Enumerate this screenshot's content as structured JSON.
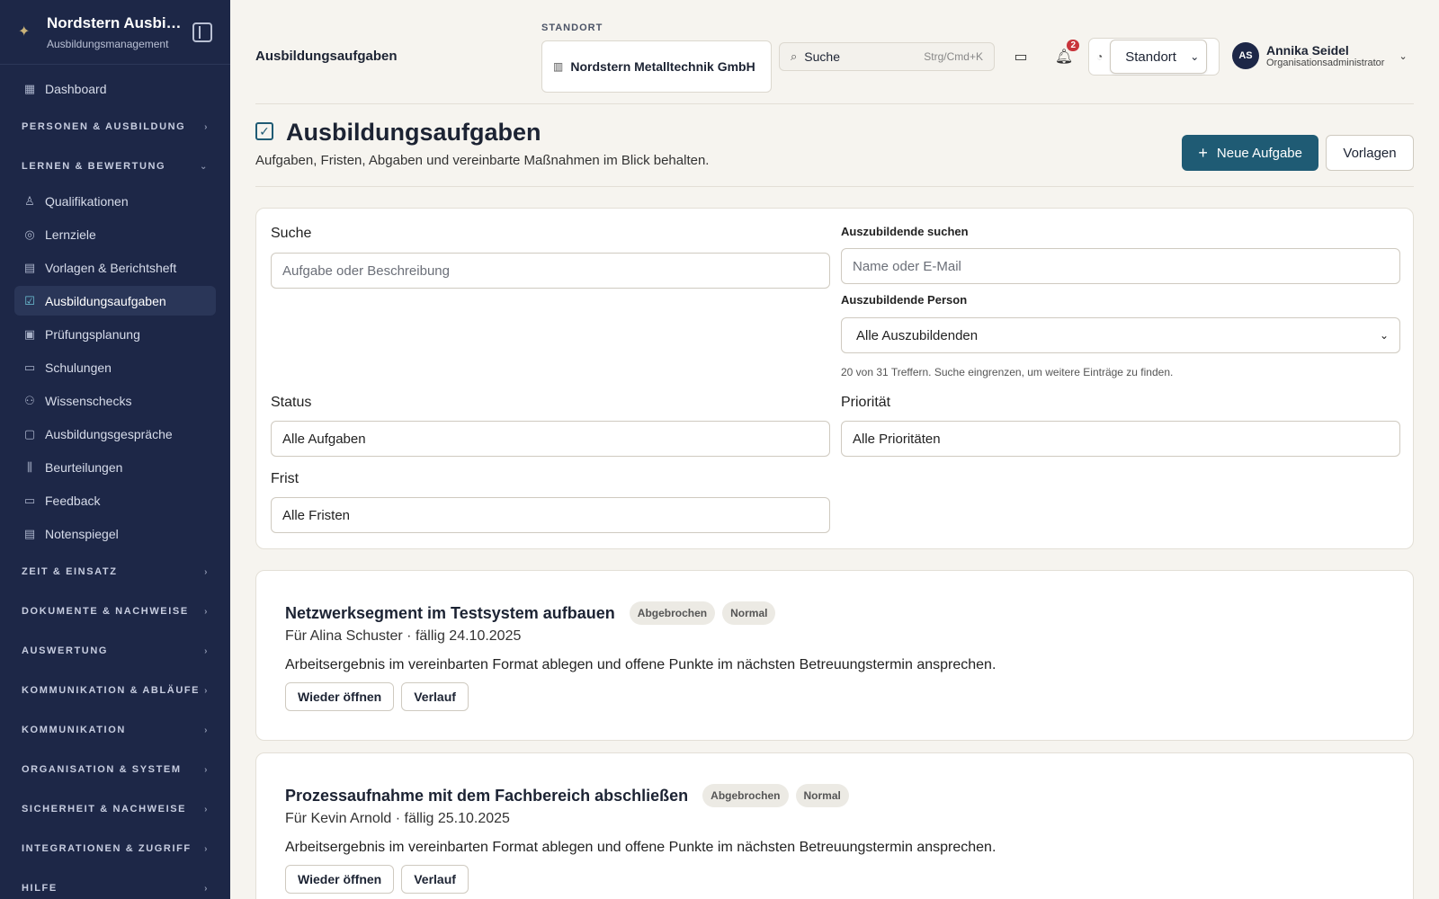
{
  "app": {
    "title": "Nordstern Ausbildungsportal",
    "subtitle": "Ausbildungsmanagement"
  },
  "sidebar": {
    "dashboard": "Dashboard",
    "sections": {
      "personen": "PERSONEN & AUSBILDUNG",
      "lernen": "LERNEN & BEWERTUNG",
      "zeit": "ZEIT & EINSATZ",
      "dokumente": "DOKUMENTE & NACHWEISE",
      "auswertung": "AUSWERTUNG",
      "kommAblaeufe": "KOMMUNIKATION & ABLÄUFE",
      "kommunikation": "KOMMUNIKATION",
      "organisation": "ORGANISATION & SYSTEM",
      "sicherheit": "SICHERHEIT & NACHWEISE",
      "integrationen": "INTEGRATIONEN & ZUGRIFF",
      "hilfe": "HILFE"
    },
    "items": [
      {
        "label": "Qualifikationen",
        "icon": "award-icon"
      },
      {
        "label": "Lernziele",
        "icon": "target-icon"
      },
      {
        "label": "Vorlagen & Berichtsheft",
        "icon": "document-icon"
      },
      {
        "label": "Ausbildungsaufgaben",
        "icon": "checkbox-icon"
      },
      {
        "label": "Prüfungsplanung",
        "icon": "calendar-icon"
      },
      {
        "label": "Schulungen",
        "icon": "book-icon"
      },
      {
        "label": "Wissenschecks",
        "icon": "brain-icon"
      },
      {
        "label": "Ausbildungsgespräche",
        "icon": "chat-icon"
      },
      {
        "label": "Beurteilungen",
        "icon": "bar-chart-icon"
      },
      {
        "label": "Feedback",
        "icon": "message-icon"
      },
      {
        "label": "Notenspiegel",
        "icon": "file-icon"
      }
    ]
  },
  "topbar": {
    "page_title": "Ausbildungsaufgaben",
    "location_label": "STANDORT",
    "location_value": "Nordstern Metalltechnik GmbH",
    "search_label": "Suche",
    "search_shortcut": "Strg/Cmd+K",
    "notifications_count": "2",
    "location_select": "Standort",
    "user_initials": "AS",
    "user_name": "Annika Seidel",
    "user_role": "Organisationsadministrator"
  },
  "page": {
    "title": "Ausbildungsaufgaben",
    "subtitle": "Aufgaben, Fristen, Abgaben und vereinbarte Maßnahmen im Blick behalten.",
    "new_button": "Neue Aufgabe",
    "templates_button": "Vorlagen"
  },
  "filters": {
    "search_label": "Suche",
    "search_placeholder": "Aufgabe oder Beschreibung",
    "trainee_search_label": "Auszubildende suchen",
    "trainee_search_placeholder": "Name oder E-Mail",
    "trainee_person_label": "Auszubildende Person",
    "trainee_person_value": "Alle Auszubildenden",
    "hint": "20 von 31 Treffern. Suche eingrenzen, um weitere Einträge zu finden.",
    "status_label": "Status",
    "status_value": "Alle Aufgaben",
    "priority_label": "Priorität",
    "priority_value": "Alle Prioritäten",
    "deadline_label": "Frist",
    "deadline_value": "Alle Fristen"
  },
  "tasks": [
    {
      "title": "Netzwerksegment im Testsystem aufbauen",
      "status": "Abgebrochen",
      "priority": "Normal",
      "meta": "Für Alina Schuster · fällig 24.10.2025",
      "description": "Arbeitsergebnis im vereinbarten Format ablegen und offene Punkte im nächsten Betreuungstermin ansprechen.",
      "reopen": "Wieder öffnen",
      "history": "Verlauf"
    },
    {
      "title": "Prozessaufnahme mit dem Fachbereich abschließen",
      "status": "Abgebrochen",
      "priority": "Normal",
      "meta": "Für Kevin Arnold · fällig 25.10.2025",
      "description": "Arbeitsergebnis im vereinbarten Format ablegen und offene Punkte im nächsten Betreuungstermin ansprechen.",
      "reopen": "Wieder öffnen",
      "history": "Verlauf"
    }
  ],
  "colors": {
    "sidebar_bg": "#1d2747",
    "accent": "#1f5b74",
    "page_bg": "#f6f4ef"
  }
}
